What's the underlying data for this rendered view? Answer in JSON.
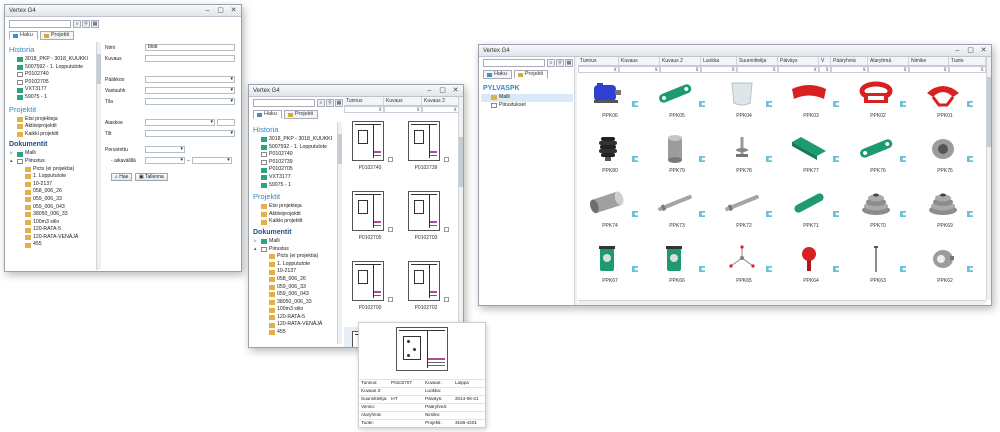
{
  "window1": {
    "title": "Vertex G4",
    "tabs": [
      {
        "label": "Haku"
      },
      {
        "label": "Projekti"
      }
    ],
    "sidebar": {
      "historia_title": "Historia",
      "historia": [
        "3018_PKP - 3018_KUUKKI",
        "5007592 - 1. Loppututote",
        "P0102740",
        "P0102705",
        "VXT3177",
        "59075 - 1"
      ],
      "projektit_title": "Projektit",
      "projektit": [
        "Etsi projekteja",
        "Aktiiviprojektit",
        "Kaikki projektit"
      ],
      "dokumentit_title": "Dokumentit",
      "dokumentit": [
        "Malli",
        "Piirustus"
      ],
      "folders": [
        "Picts (ei projektia)",
        "1. Loppututote",
        "10-2137",
        "058_006_26",
        "059_006_33",
        "059_006_043",
        "38050_006_33",
        "100m3 siilo",
        "120-RATA-5",
        "120-RATA-VENÄJÄ",
        "455"
      ]
    },
    "form": {
      "nimi_label": "Nimi",
      "nimi_value": "blob",
      "kuvaus_label": "Kuvaus",
      "paakkoo_label": "Pääkkoo",
      "vastuuhk_label": "Vastuuhk",
      "tila_label": "Tila",
      "pvm_label": "Pvm",
      "jotakin_label": "Aiaskoe",
      "tilt_label": "Tilt",
      "perustettu_label": "Perustettu",
      "aikavali_label": "- aikavälillä",
      "hae_button": "Hae",
      "tallenna_button": "Tallenna"
    }
  },
  "window2": {
    "title": "Vertex G4",
    "tabs": [
      {
        "label": "Haku"
      },
      {
        "label": "Projekti"
      }
    ],
    "columns": [
      "Tunnus",
      "Kuvaus",
      "Kuvaus 2"
    ],
    "sidebar": {
      "historia_title": "Historia",
      "historia": [
        "3018_PKP - 3018_KUUKKI",
        "5007592 - 1. Loppututote",
        "P0102740",
        "P0102739",
        "P0102705",
        "VXT3177",
        "59075 - 1"
      ],
      "projektit_title": "Projektit",
      "projektit": [
        "Etsi projekteja",
        "Aktiiviprojektit",
        "Kaikki projektit"
      ],
      "dokumentit_title": "Dokumentit",
      "dokumentit": [
        "Malli",
        "Piirustus"
      ],
      "folders": [
        "Picts (ei projektia)",
        "1. Loppututote",
        "10-2137",
        "058_006_26",
        "059_006_33",
        "059_006_043",
        "38050_006_33",
        "100m3 siilo",
        "120-RATA-5",
        "120-RATA-VENÄJÄ",
        "455"
      ]
    },
    "drawings": [
      "P0102740",
      "P0102739",
      "P0102705",
      "P0102703",
      "P0102700",
      "P0102702",
      "P0102707"
    ]
  },
  "window3": {
    "title": "Vertex G4",
    "tabs": [
      {
        "label": "Haku"
      },
      {
        "label": "Projekti"
      }
    ],
    "project_title": "PYLVASPK",
    "tree": [
      "Malli",
      "Piirustukset"
    ],
    "columns": [
      "Tunnus",
      "Kuvaus",
      "Kuvaus 2",
      "Luokka",
      "Suunnittelija",
      "Päiväys",
      "V",
      "Pääryhmä",
      "Alaryhmä",
      "Nimike",
      "Tuote"
    ],
    "parts": [
      {
        "code": "PPK06",
        "shape": "motor",
        "color": "#2f3fd1"
      },
      {
        "code": "PPK05",
        "shape": "plate",
        "color": "#1f9a6f"
      },
      {
        "code": "PPK04",
        "shape": "cup",
        "color": "#dfe6ea"
      },
      {
        "code": "PPK03",
        "shape": "redcurve",
        "color": "#d92020"
      },
      {
        "code": "PPK02",
        "shape": "redring",
        "color": "#d92020"
      },
      {
        "code": "PPK01",
        "shape": "redsplit",
        "color": "#d92020"
      },
      {
        "code": "PPK80",
        "shape": "bellows",
        "color": "#222222"
      },
      {
        "code": "PPK79",
        "shape": "cylinder",
        "color": "#9c9c9c"
      },
      {
        "code": "PPK78",
        "shape": "bolt",
        "color": "#9a9a9a"
      },
      {
        "code": "PPK77",
        "shape": "bracket",
        "color": "#1f9a6f"
      },
      {
        "code": "PPK76",
        "shape": "plate",
        "color": "#1f9a6f"
      },
      {
        "code": "PPK75",
        "shape": "bushing",
        "color": "#9c9c9c"
      },
      {
        "code": "PPK74",
        "shape": "roller",
        "color": "#a0a0a0"
      },
      {
        "code": "PPK73",
        "shape": "rod",
        "color": "#a5a5a5"
      },
      {
        "code": "PPK72",
        "shape": "rod",
        "color": "#a5a5a5"
      },
      {
        "code": "PPK71",
        "shape": "bar",
        "color": "#1f9a6f"
      },
      {
        "code": "PPK70",
        "shape": "pulley",
        "color": "#8c8c8c"
      },
      {
        "code": "PPK69",
        "shape": "pulley",
        "color": "#8c8c8c"
      },
      {
        "code": "PPK67",
        "shape": "bearing",
        "color": "#1f9a6f"
      },
      {
        "code": "PPK66",
        "shape": "bearing",
        "color": "#1f9a6f"
      },
      {
        "code": "PPK65",
        "shape": "tripod",
        "color": "#d92020"
      },
      {
        "code": "PPK64",
        "shape": "knob",
        "color": "#d92020"
      },
      {
        "code": "PPK63",
        "shape": "pin",
        "color": "#8c8c8c"
      },
      {
        "code": "PPK62",
        "shape": "collar",
        "color": "#9c9c9c"
      }
    ]
  },
  "card": {
    "rows": [
      [
        "Tunnus:",
        "P0102707",
        "Kuvaus:",
        "Laippa"
      ],
      [
        "Kuvaus 2:",
        "",
        "Luokka:",
        ""
      ],
      [
        "Suunnittelija:",
        "IAT",
        "Päiväys:",
        "2014-06-21"
      ],
      [
        "Versio:",
        "",
        "Pääryhmä:",
        ""
      ],
      [
        "Alaryhmä:",
        "",
        "Nimike:",
        ""
      ],
      [
        "Tuote:",
        "",
        "Projekti:",
        "3166-4201"
      ]
    ]
  }
}
